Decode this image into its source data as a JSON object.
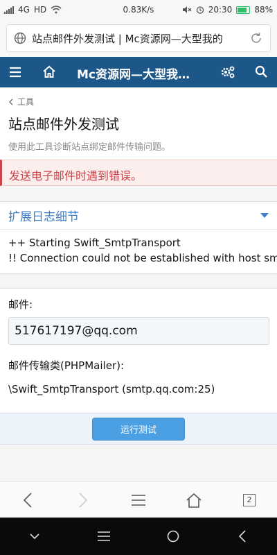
{
  "status_bar": {
    "network_type": "4G",
    "hd": "HD",
    "speed": "0.83K/s",
    "time": "20:30",
    "battery": "88%"
  },
  "url_bar": {
    "url_text": "站点邮件外发测试 | Mc资源网—大型我的"
  },
  "navbar": {
    "title": "Mc资源网—大型我…"
  },
  "page": {
    "breadcrumb": "工具",
    "title": "站点邮件外发测试",
    "description": "使用此工具诊断站点绑定邮件传输问题。"
  },
  "error": {
    "message": "发送电子邮件时遇到错误。"
  },
  "log": {
    "header": "扩展日志细节",
    "lines": [
      "++ Starting Swift_SmtpTransport",
      "!! Connection could not be established with host smtp.qq.com"
    ]
  },
  "form": {
    "email_label": "邮件:",
    "email_value": "517617197@qq.com",
    "transport_label": "邮件传输类(PHPMailer):",
    "transport_value": "\\Swift_SmtpTransport (smtp.qq.com:25)",
    "submit_label": "运行测试"
  },
  "browser_bar": {
    "tab_count": "2"
  },
  "colors": {
    "navbar": "#1d5688",
    "error_text": "#c84448",
    "link_blue": "#3b80c6",
    "button": "#4aa0e3"
  }
}
